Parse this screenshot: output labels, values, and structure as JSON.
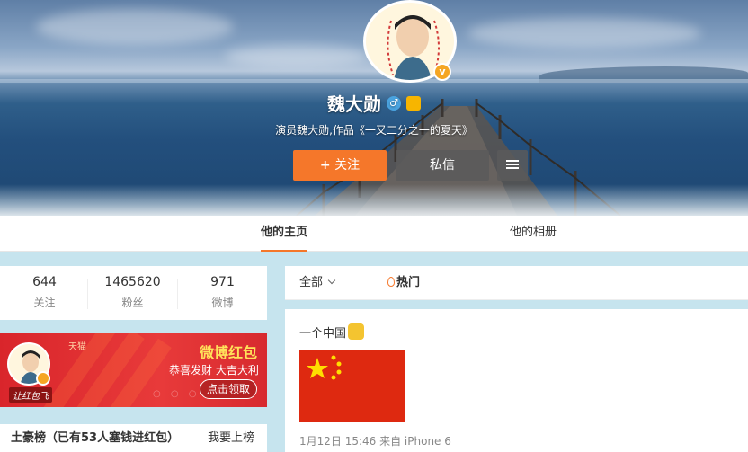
{
  "profile": {
    "name": "魏大勋",
    "bio": "演员魏大勋,作品《一又二分之一的夏天》",
    "follow_label": "关注",
    "message_label": "私信"
  },
  "tabs": [
    {
      "label": "他的主页"
    },
    {
      "label": "他的相册"
    }
  ],
  "stats": [
    {
      "value": "644",
      "label": "关注"
    },
    {
      "value": "1465620",
      "label": "粉丝"
    },
    {
      "value": "971",
      "label": "微博"
    }
  ],
  "ad": {
    "brand": "天猫",
    "title": "微博红包",
    "subtitle": "恭喜发财 大吉大利",
    "button_label": "点击领取",
    "avatar_tag": "让红包飞"
  },
  "rank": {
    "title": "土豪榜（已有53人塞钱进红包）",
    "link_label": "我要上榜"
  },
  "feed": {
    "filter_all": "全部",
    "filter_hot": "热门",
    "post": {
      "text": "一个中国",
      "meta": "1月12日 15:46 来自 iPhone 6"
    }
  },
  "colors": {
    "accent": "#f5772a",
    "page_bg": "#c6e4ee",
    "ad_red": "#d9252b",
    "flag_red": "#de2910",
    "flag_yellow": "#ffde00"
  },
  "icons": [
    "plus-icon",
    "gender-male-icon",
    "vip-icon",
    "verified-badge-icon",
    "menu-icon",
    "chevron-down-icon",
    "fire-icon",
    "hand-emoji-icon"
  ]
}
